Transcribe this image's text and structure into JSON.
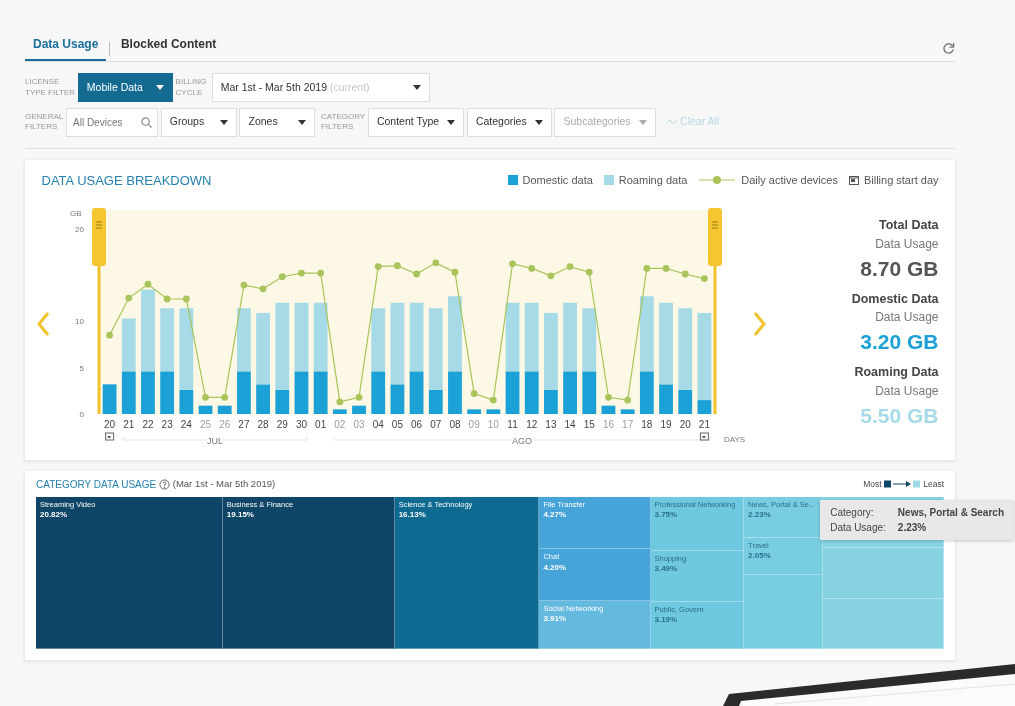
{
  "tabs": [
    {
      "label": "Data Usage",
      "selected": true
    },
    {
      "label": "Blocked Content",
      "selected": false
    }
  ],
  "filters": {
    "license": {
      "label_lines": [
        "LICENSE",
        "TYPE FILTER"
      ],
      "value": "Mobile Data"
    },
    "billing": {
      "label_lines": [
        "BILLING",
        "CYCLE"
      ],
      "value": "Mar 1st - Mar 5th 2019",
      "note": "(current)"
    },
    "general_label_lines": [
      "GENERAL",
      "FILTERS"
    ],
    "search": {
      "placeholder": "All Devices"
    },
    "general_dropdowns": [
      {
        "label": "Groups",
        "disabled": false
      },
      {
        "label": "Zones",
        "disabled": false
      }
    ],
    "category_label_lines": [
      "CATEGORY",
      "FILTERS"
    ],
    "category_dropdowns": [
      {
        "label": "Content Type",
        "disabled": false
      },
      {
        "label": "Categories",
        "disabled": false
      },
      {
        "label": "Subcategories",
        "disabled": true
      }
    ],
    "clear_all": {
      "label": "Clear All",
      "disabled": true
    }
  },
  "breakdown": {
    "title": "DATA USAGE BREAKDOWN",
    "billing_legend": "Billing start day",
    "months": [
      "JUL",
      "AGO"
    ],
    "day_dimmed": [
      false,
      false,
      false,
      false,
      false,
      true,
      true,
      false,
      false,
      false,
      false,
      false,
      true,
      true,
      false,
      false,
      false,
      false,
      false,
      true,
      true,
      false,
      false,
      false,
      false,
      false,
      true,
      true,
      false,
      false,
      false,
      false
    ],
    "chart_data": {
      "type": "bar",
      "stacked": true,
      "ylabel": "GB",
      "xlabel": "DAYS",
      "ylim": [
        0,
        22
      ],
      "yticks": [
        0,
        5,
        10,
        20
      ],
      "categories": [
        "20",
        "21",
        "22",
        "23",
        "24",
        "25",
        "26",
        "27",
        "28",
        "29",
        "30",
        "01",
        "02",
        "03",
        "04",
        "05",
        "06",
        "07",
        "08",
        "09",
        "10",
        "11",
        "12",
        "13",
        "14",
        "15",
        "16",
        "17",
        "18",
        "19",
        "20",
        "21"
      ],
      "series": [
        {
          "name": "Domestic data",
          "type": "bar",
          "color": "#1ba1d6",
          "values": [
            3.2,
            4.6,
            4.6,
            4.6,
            2.6,
            0.9,
            0.9,
            4.6,
            3.2,
            2.6,
            4.6,
            4.6,
            0.5,
            0.9,
            4.6,
            3.2,
            4.6,
            2.6,
            4.6,
            0.5,
            0.5,
            4.6,
            4.6,
            2.6,
            4.6,
            4.6,
            0.9,
            0.5,
            4.6,
            3.2,
            2.6,
            1.5
          ]
        },
        {
          "name": "Roaming data",
          "type": "bar",
          "color": "#a6dae6",
          "values": [
            0,
            5.7,
            8.8,
            6.8,
            8.8,
            0,
            0,
            6.8,
            7.7,
            9.4,
            7.4,
            7.4,
            0,
            0,
            6.8,
            8.8,
            7.4,
            8.8,
            8.1,
            0,
            0,
            7.4,
            7.4,
            8.3,
            7.4,
            6.8,
            0,
            0,
            8.1,
            8.8,
            8.8,
            9.4
          ]
        },
        {
          "name": "Daily active devices",
          "type": "line",
          "marker": true,
          "color": "#a9c45a",
          "values": [
            8.5,
            12.5,
            14,
            12.4,
            12.4,
            1.8,
            1.8,
            13.9,
            13.5,
            14.8,
            15.2,
            15.2,
            1.3,
            1.8,
            15.9,
            16,
            15.1,
            16.3,
            15.3,
            2.2,
            1.5,
            16.2,
            15.7,
            14.9,
            15.9,
            15.3,
            1.8,
            1.5,
            15.7,
            15.7,
            15.1,
            14.6
          ]
        }
      ]
    },
    "stats": [
      {
        "title": "Total Data",
        "subtitle": "Data Usage",
        "value": "8.70 GB",
        "color": "#555555"
      },
      {
        "title": "Domestic Data",
        "subtitle": "Data Usage",
        "value": "3.20 GB",
        "color": "#1ba1d6"
      },
      {
        "title": "Roaming Data",
        "subtitle": "Data Usage",
        "value": "5.50 GB",
        "color": "#a6dae6"
      }
    ]
  },
  "category": {
    "title": "CATEGORY DATA USAGE",
    "period": "(Mar 1st - Mar 5th 2019)",
    "legend_most": "Most",
    "legend_least": "Least",
    "columns": [
      {
        "cells": [
          {
            "label": "Streaming Video",
            "value": "20.82%",
            "color": "#0f4566"
          }
        ]
      },
      {
        "cells": [
          {
            "label": "Business & Finance",
            "value": "19.15%",
            "color": "#0f4566"
          }
        ]
      },
      {
        "cells": [
          {
            "label": "Science & Technology",
            "value": "16.13%",
            "color": "#0e6a90"
          }
        ]
      },
      {
        "cells": [
          {
            "label": "File Transfer",
            "value": "4.27%",
            "color": "#47a4d8"
          },
          {
            "label": "Chat",
            "value": "4.20%",
            "color": "#47a4d8"
          },
          {
            "label": "Social Networking",
            "value": "3.91%",
            "color": "#63b9de"
          }
        ]
      },
      {
        "cells": [
          {
            "label": "Professional Networking",
            "value": "3.75%",
            "color": "#6ec8e0"
          },
          {
            "label": "Shopping",
            "value": "3.49%",
            "color": "#6ec8e0"
          },
          {
            "label": "Public, Govern",
            "value": "3.19%",
            "color": "#6ec8e0"
          }
        ]
      },
      {
        "cells": [
          {
            "label": "News, Portal & Se...",
            "value": "2.23%",
            "color": "#79cde1"
          },
          {
            "label": "Travel",
            "value": "2.05%",
            "color": "#79cde1"
          },
          {
            "color": "#79cde1"
          }
        ]
      },
      {
        "cells": [
          {
            "color": "#86d2e3"
          },
          {
            "color": "#86d2e3"
          },
          {
            "color": "#86d2e3"
          }
        ]
      }
    ],
    "tooltip": [
      {
        "key": "Category:",
        "value": "News, Portal & Search"
      },
      {
        "key": "Data Usage:",
        "value": "2.23%"
      }
    ]
  }
}
